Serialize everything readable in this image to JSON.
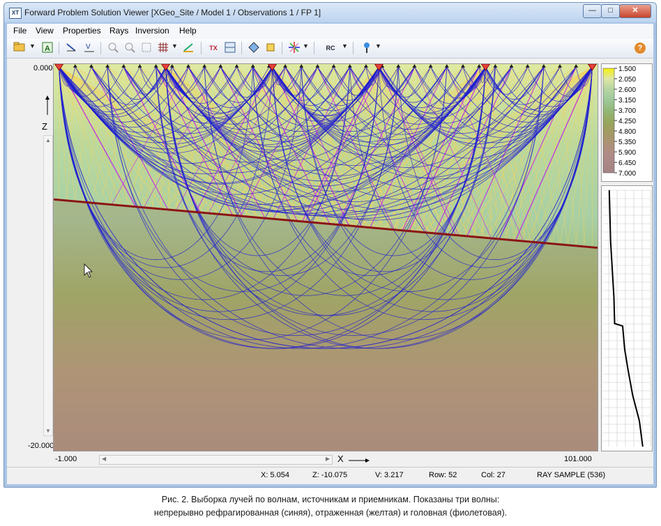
{
  "window": {
    "title": "Forward Problem Solution Viewer [XGeo_Site / Model 1 / Observations 1 / FP 1]",
    "icon_text": "XT",
    "minimize": "—",
    "maximize": "□",
    "close": "✕"
  },
  "menu": [
    "File",
    "View",
    "Properties",
    "Rays",
    "Inversion",
    "Help"
  ],
  "toolbar": {
    "icons": [
      "open-icon",
      "dropdown-icon",
      "text-a-icon",
      "ruler-icon",
      "v-arrow-icon",
      "zoom-in-icon",
      "zoom-out-icon",
      "zoom-fit-icon",
      "grid-icon",
      "grid-dropdown-icon",
      "line-tool-icon",
      "tx-icon",
      "layout-icon",
      "fill-icon",
      "crop-icon",
      "star-icon",
      "star-dropdown-icon",
      "rc-icon",
      "rc-dropdown-icon",
      "pin-icon",
      "pin-dropdown-icon",
      "help-icon"
    ],
    "tx_label": "TX",
    "rc_label": "RC",
    "help_label": "?"
  },
  "plot": {
    "y_top_label": "0.000",
    "y_bottom_label": "-20.000",
    "x_left_label": "-1.000",
    "x_right_label": "101.000",
    "z_axis_label": "Z",
    "x_axis_label": "X",
    "background_colors": [
      "#dfe9a0",
      "#b9d9a0",
      "#a7cfa5",
      "#9fb36a",
      "#b79a84",
      "#b08d8c"
    ],
    "ray_colors": {
      "refracted": "#1f1fcf",
      "reflected": "#f3d45c",
      "head": "#c23ae0"
    },
    "interface_color": "#8b1414",
    "source_positions_x": [
      0,
      20,
      40,
      60,
      80,
      100
    ],
    "interface_z_left": -7.0,
    "interface_z_right": -9.5,
    "x_range": [
      -1,
      101
    ],
    "z_range": [
      -20,
      0
    ]
  },
  "colorscale": {
    "values": [
      "1.500",
      "2.050",
      "2.600",
      "3.150",
      "3.700",
      "4.250",
      "4.800",
      "5.350",
      "5.900",
      "6.450",
      "7.000"
    ],
    "colors": [
      "#f4f10c",
      "#dfe7a5",
      "#b6d5a1",
      "#9fc99b",
      "#93b978",
      "#96a85e",
      "#a19b62",
      "#ab9372",
      "#b08c84",
      "#ab8888",
      "#a58585"
    ]
  },
  "velocity_profile": {
    "points": [
      [
        0.05,
        0.0
      ],
      [
        0.07,
        0.2
      ],
      [
        0.12,
        0.42
      ],
      [
        0.13,
        0.52
      ],
      [
        0.25,
        0.53
      ],
      [
        0.28,
        0.62
      ],
      [
        0.33,
        0.7
      ],
      [
        0.4,
        0.8
      ],
      [
        0.5,
        0.9
      ],
      [
        0.55,
        1.0
      ]
    ]
  },
  "status": {
    "x": "X: 5.054",
    "z": "Z: -10.075",
    "v": "V: 3.217",
    "row": "Row: 52",
    "col": "Col: 27",
    "mode": "RAY SAMPLE (536)"
  },
  "caption": {
    "line1": "Рис. 2. Выборка лучей по волнам, источникам и приемникам. Показаны три волны:",
    "line2": "непрерывно рефрагированная (синяя), отраженная (желтая) и головная (фиолетовая)."
  }
}
